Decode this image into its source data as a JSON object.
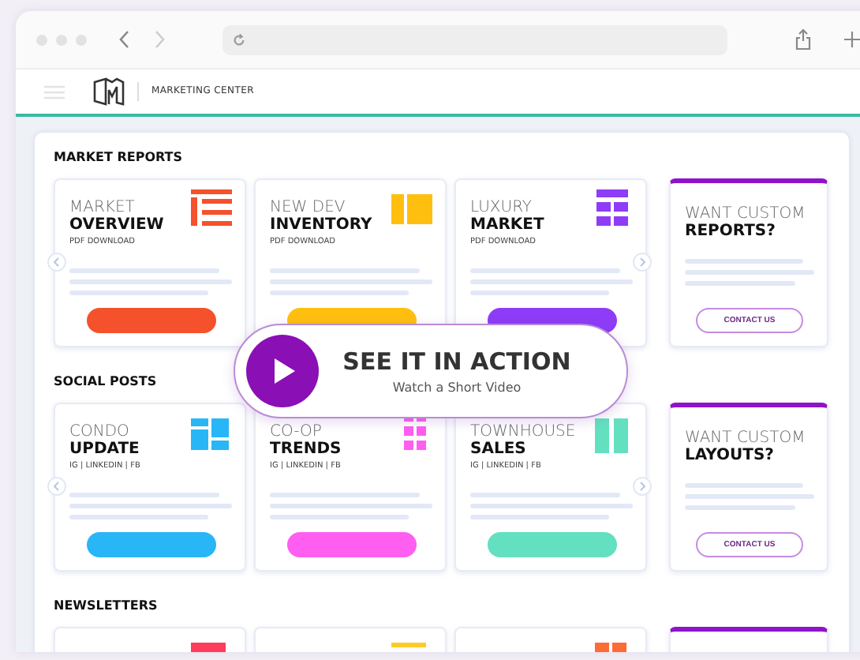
{
  "header": {
    "brand": "MARKETING CENTER"
  },
  "sections": [
    {
      "title": "MARKET REPORTS",
      "cards": [
        {
          "line1": "MARKET",
          "line2": "OVERVIEW",
          "subtitle": "PDF DOWNLOAD",
          "color": "#f4512c",
          "kind": "list"
        },
        {
          "line1": "NEW DEV",
          "line2": "INVENTORY",
          "subtitle": "PDF DOWNLOAD",
          "color": "#ffbf0f",
          "kind": "split"
        },
        {
          "line1": "LUXURY",
          "line2": "MARKET",
          "subtitle": "PDF DOWNLOAD",
          "color": "#8e3cf7",
          "kind": "tiles"
        }
      ],
      "custom": {
        "line1": "WANT CUSTOM",
        "line2": "REPORTS?",
        "button": "CONTACT US"
      }
    },
    {
      "title": "SOCIAL POSTS",
      "cards": [
        {
          "line1": "CONDO",
          "line2": "UPDATE",
          "subtitle": "IG | LINKEDIN | FB",
          "color": "#29b6f6",
          "kind": "mosaic"
        },
        {
          "line1": "CO-OP",
          "line2": "TRENDS",
          "subtitle": "IG | LINKEDIN | FB",
          "color": "#ff5ef0",
          "kind": "dots"
        },
        {
          "line1": "TOWNHOUSE",
          "line2": "SALES",
          "subtitle": "IG | LINKEDIN | FB",
          "color": "#63e0c0",
          "kind": "columns"
        }
      ],
      "custom": {
        "line1": "WANT CUSTOM",
        "line2": "LAYOUTS?",
        "button": "CONTACT US"
      }
    },
    {
      "title": "NEWSLETTERS",
      "cards": [
        {
          "color": "#ff3d5a",
          "kind": "header"
        },
        {
          "color": "#ffc928",
          "kind": "lines"
        },
        {
          "color": "#ff6b35",
          "kind": "grid"
        }
      ]
    }
  ],
  "video": {
    "title": "SEE IT IN ACTION",
    "subtitle": "Watch a Short Video"
  }
}
